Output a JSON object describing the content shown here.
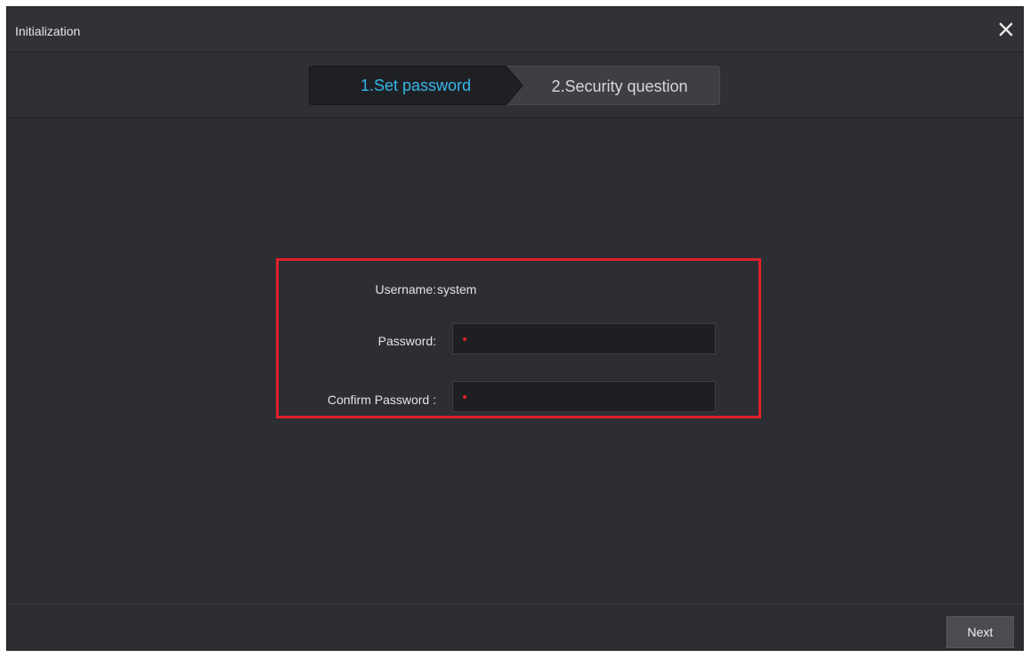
{
  "window": {
    "title": "Initialization",
    "close_icon": "close-icon"
  },
  "steps": [
    {
      "label": "1.Set password",
      "active": true,
      "color": "#35b6ea"
    },
    {
      "label": "2.Security question",
      "active": false
    }
  ],
  "form": {
    "username_label": "Username:",
    "username_value": "system",
    "password_label": "Password:",
    "password_value": "",
    "confirm_label": "Confirm Password :",
    "confirm_value": "",
    "required_marker_color": "#e0202a",
    "highlight_color": "#e0202a"
  },
  "footer": {
    "next_label": "Next"
  }
}
